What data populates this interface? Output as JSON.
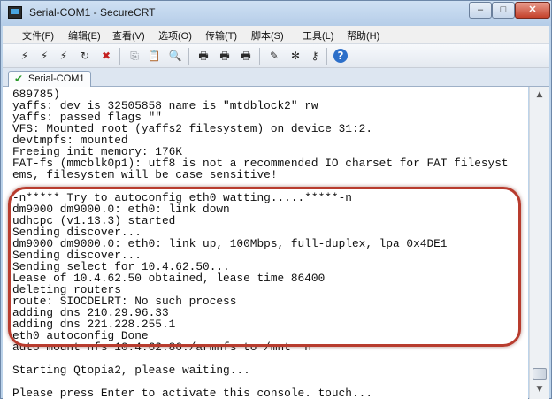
{
  "window": {
    "title": "Serial-COM1 - SecureCRT",
    "controls": {
      "minimize": "–",
      "maximize": "□",
      "close": "✕"
    }
  },
  "menu": {
    "items": [
      "文件(F)",
      "编辑(E)",
      "查看(V)",
      "选项(O)",
      "传输(T)",
      "脚本(S)",
      "工具(L)",
      "帮助(H)"
    ]
  },
  "toolbar": {
    "icons": [
      {
        "name": "connect-icon",
        "glyph": "⚡"
      },
      {
        "name": "quick-connect-icon",
        "glyph": "⚡"
      },
      {
        "name": "connect-tab-icon",
        "glyph": "⚡"
      },
      {
        "name": "reconnect-icon",
        "glyph": "↻"
      },
      {
        "name": "disconnect-icon",
        "glyph": "✖"
      },
      {
        "name": "copy-icon",
        "glyph": "⎘"
      },
      {
        "name": "paste-icon",
        "glyph": "📋"
      },
      {
        "name": "find-icon",
        "glyph": "🔍"
      },
      {
        "name": "print-setup-icon",
        "glyph": "🖶"
      },
      {
        "name": "print-icon",
        "glyph": "🖶"
      },
      {
        "name": "log-icon",
        "glyph": "🖶"
      },
      {
        "name": "session-options-icon",
        "glyph": "✎"
      },
      {
        "name": "global-options-icon",
        "glyph": "✻"
      },
      {
        "name": "keymap-icon",
        "glyph": "⚷"
      },
      {
        "name": "help-icon",
        "glyph": "?"
      }
    ]
  },
  "tab": {
    "label": "Serial-COM1",
    "status_icon": "checkmark-icon"
  },
  "terminal": {
    "lines": [
      "689785)",
      "yaffs: dev is 32505858 name is \"mtdblock2\" rw",
      "yaffs: passed flags \"\"",
      "VFS: Mounted root (yaffs2 filesystem) on device 31:2.",
      "devtmpfs: mounted",
      "Freeing init memory: 176K",
      "FAT-fs (mmcblk0p1): utf8 is not a recommended IO charset for FAT filesyst",
      "ems, filesystem will be case sensitive!",
      "",
      "-n***** Try to autoconfig eth0 watting.....*****-n",
      "dm9000 dm9000.0: eth0: link down",
      "udhcpc (v1.13.3) started",
      "Sending discover...",
      "dm9000 dm9000.0: eth0: link up, 100Mbps, full-duplex, lpa 0x4DE1",
      "Sending discover...",
      "Sending select for 10.4.62.50...",
      "Lease of 10.4.62.50 obtained, lease time 86400",
      "deleting routers",
      "route: SIOCDELRT: No such process",
      "adding dns 210.29.96.33",
      "adding dns 221.228.255.1",
      "eth0 autoconfig Done",
      "auto mount nfs 10.4.62.86:/armnfs to /mnt  n",
      "",
      "Starting Qtopia2, please waiting...",
      "",
      "Please press Enter to activate this console. touch..."
    ]
  },
  "colors": {
    "highlight_frame": "#b83c2e",
    "window_frame": "#bcd3ea",
    "terminal_bg": "#ffffff",
    "terminal_text": "#101010"
  }
}
